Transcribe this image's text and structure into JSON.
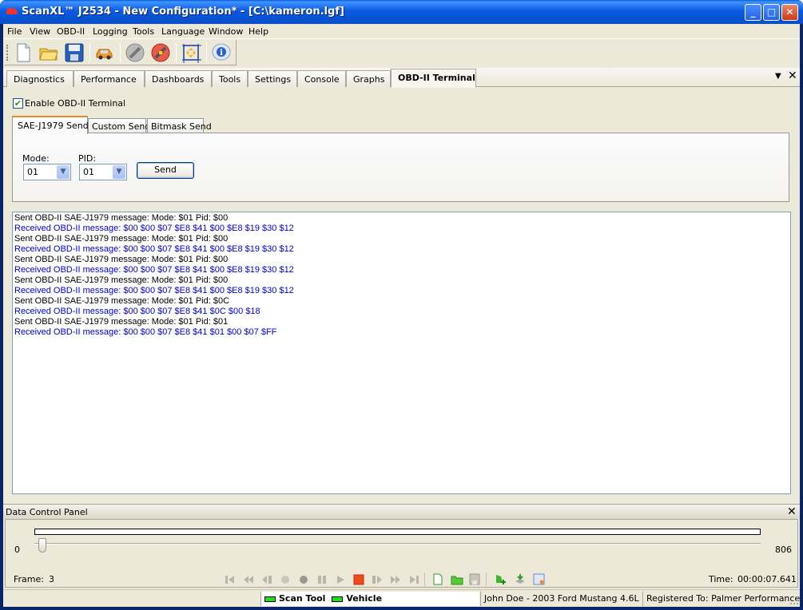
{
  "window": {
    "title": "ScanXL™ J2534 - New Configuration* - [C:\\kameron.lgf]",
    "minimize": "_",
    "maximize": "□",
    "close": "✕"
  },
  "menu": [
    "File",
    "View",
    "OBD-II",
    "Logging",
    "Tools",
    "Language",
    "Window",
    "Help"
  ],
  "toolbar": {
    "icons": [
      "new-file-icon",
      "open-folder-icon",
      "save-icon",
      "vehicle-icon",
      "disconnect-icon",
      "connect-icon",
      "fit-view-icon",
      "info-icon"
    ]
  },
  "tabs": [
    {
      "label": "Diagnostics",
      "active": false
    },
    {
      "label": "Performance",
      "active": false
    },
    {
      "label": "Dashboards",
      "active": false
    },
    {
      "label": "Tools",
      "active": false
    },
    {
      "label": "Settings",
      "active": false
    },
    {
      "label": "Console",
      "active": false
    },
    {
      "label": "Graphs",
      "active": false
    },
    {
      "label": "OBD-II Terminal",
      "active": true
    }
  ],
  "terminal": {
    "enable_label": "Enable OBD-II Terminal",
    "enabled": true,
    "subtabs": [
      "SAE-J1979 Send",
      "Custom Send",
      "Bitmask Send"
    ],
    "mode_label": "Mode:",
    "mode_value": "01",
    "pid_label": "PID:",
    "pid_value": "01",
    "send_label": "Send",
    "log": [
      {
        "type": "sent",
        "text": "Sent OBD-II SAE-J1979 message: Mode: $01 Pid: $00"
      },
      {
        "type": "recv",
        "text": "Received OBD-II message: $00 $00 $07 $E8 $41 $00 $E8 $19 $30 $12"
      },
      {
        "type": "sent",
        "text": "Sent OBD-II SAE-J1979 message: Mode: $01 Pid: $00"
      },
      {
        "type": "recv",
        "text": "Received OBD-II message: $00 $00 $07 $E8 $41 $00 $E8 $19 $30 $12"
      },
      {
        "type": "sent",
        "text": "Sent OBD-II SAE-J1979 message: Mode: $01 Pid: $00"
      },
      {
        "type": "recv",
        "text": "Received OBD-II message: $00 $00 $07 $E8 $41 $00 $E8 $19 $30 $12"
      },
      {
        "type": "sent",
        "text": "Sent OBD-II SAE-J1979 message: Mode: $01 Pid: $00"
      },
      {
        "type": "recv",
        "text": "Received OBD-II message: $00 $00 $07 $E8 $41 $00 $E8 $19 $30 $12"
      },
      {
        "type": "sent",
        "text": "Sent OBD-II SAE-J1979 message: Mode: $01 Pid: $0C"
      },
      {
        "type": "recv",
        "text": "Received OBD-II message: $00 $00 $07 $E8 $41 $0C $00 $18"
      },
      {
        "type": "sent",
        "text": "Sent OBD-II SAE-J1979 message: Mode: $01 Pid: $01"
      },
      {
        "type": "recv",
        "text": "Received OBD-II message: $00 $00 $07 $E8 $41 $01 $00 $07 $FF"
      }
    ],
    "colors": {
      "sent": "#000000",
      "recv": "#0000e0"
    }
  },
  "dcp": {
    "title": "Data Control Panel",
    "min": "0",
    "max": "806",
    "slider_value": 3,
    "frame_label": "Frame:",
    "frame_value": "3",
    "time_label": "Time:",
    "time_value": "00:00:07.641",
    "playback_icons": [
      "first-icon",
      "rewind-icon",
      "step-back-icon",
      "record-light-icon",
      "record-dark-icon",
      "pause-icon",
      "play-icon",
      "stop-icon",
      "step-forward-icon",
      "fast-forward-icon",
      "last-icon",
      "new-log-icon",
      "open-log-icon",
      "save-log-icon",
      "add-marker-icon",
      "export-icon",
      "zoom-fit-icon"
    ]
  },
  "status": {
    "scan_tool": "Scan Tool",
    "vehicle": "Vehicle",
    "vehicle_info": "John Doe - 2003 Ford Mustang 4.6L",
    "registered": "Registered To: Palmer Performance",
    "led_color": "#1ee01e"
  }
}
